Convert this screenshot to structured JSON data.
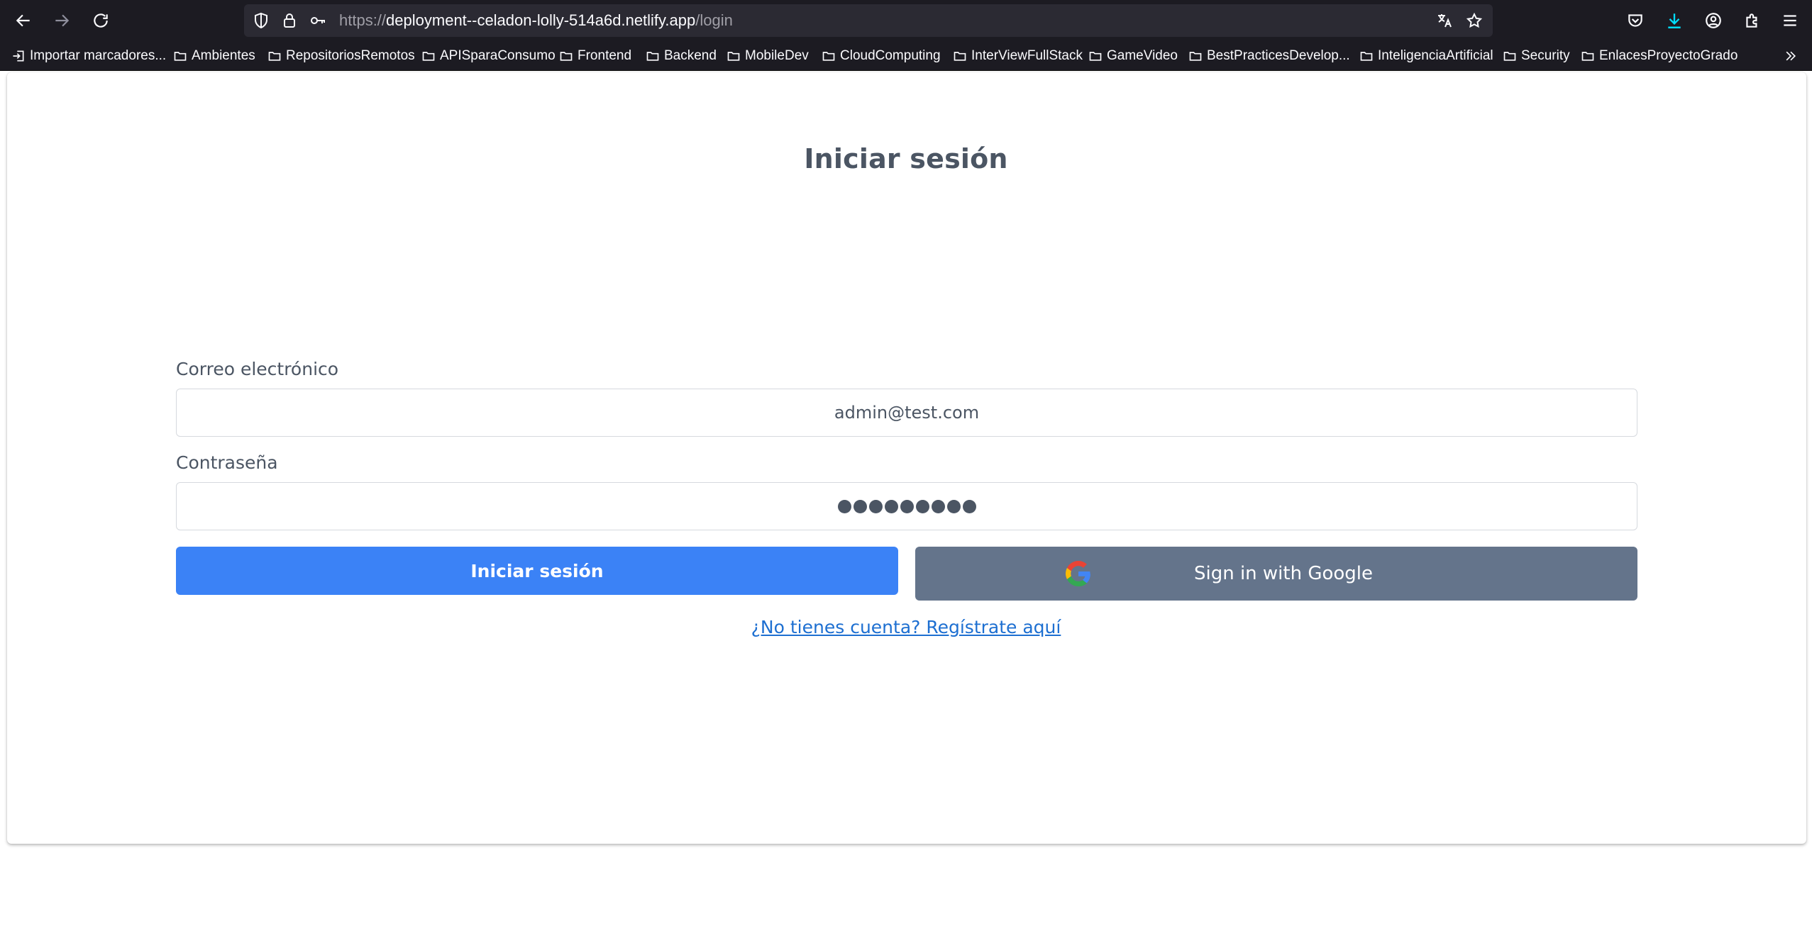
{
  "browser": {
    "url_prefix": "https://",
    "url_host": "deployment--celadon-lolly-514a6d.netlify.app",
    "url_path": "/login",
    "icons": {
      "back": "arrow-left-icon",
      "forward": "arrow-right-icon",
      "reload": "reload-icon",
      "shield": "shield-icon",
      "lock": "lock-icon",
      "key": "key-icon",
      "translate": "translate-icon",
      "bookmark": "star-icon",
      "pocket": "pocket-icon",
      "downloads": "download-icon",
      "account": "account-icon",
      "extensions": "puzzle-icon",
      "menu": "hamburger-icon"
    },
    "accent_color": "#00ddff"
  },
  "bookmarks": {
    "import_label": "Importar marcadores...",
    "folders": [
      "Ambientes",
      "RepositoriosRemotos",
      "APISparaConsumo",
      "Frontend",
      "Backend",
      "MobileDev",
      "CloudComputing",
      "InterViewFullStack",
      "GameVideo",
      "BestPracticesDevelop...",
      "InteligenciaArtificial",
      "Security",
      "EnlacesProyectoGrado"
    ],
    "overflow_icon": "chevron-double-right-icon"
  },
  "login": {
    "title": "Iniciar sesión",
    "email_label": "Correo electrónico",
    "email_value": "admin@test.com",
    "password_label": "Contraseña",
    "password_masked_length": 9,
    "submit_label": "Iniciar sesión",
    "google_label": "Sign in with Google",
    "register_link": "¿No tienes cuenta? Regístrate aquí",
    "colors": {
      "primary": "#3b82f6",
      "google_button": "#64748b",
      "link": "#1d6fd1",
      "text": "#4b5563"
    }
  }
}
